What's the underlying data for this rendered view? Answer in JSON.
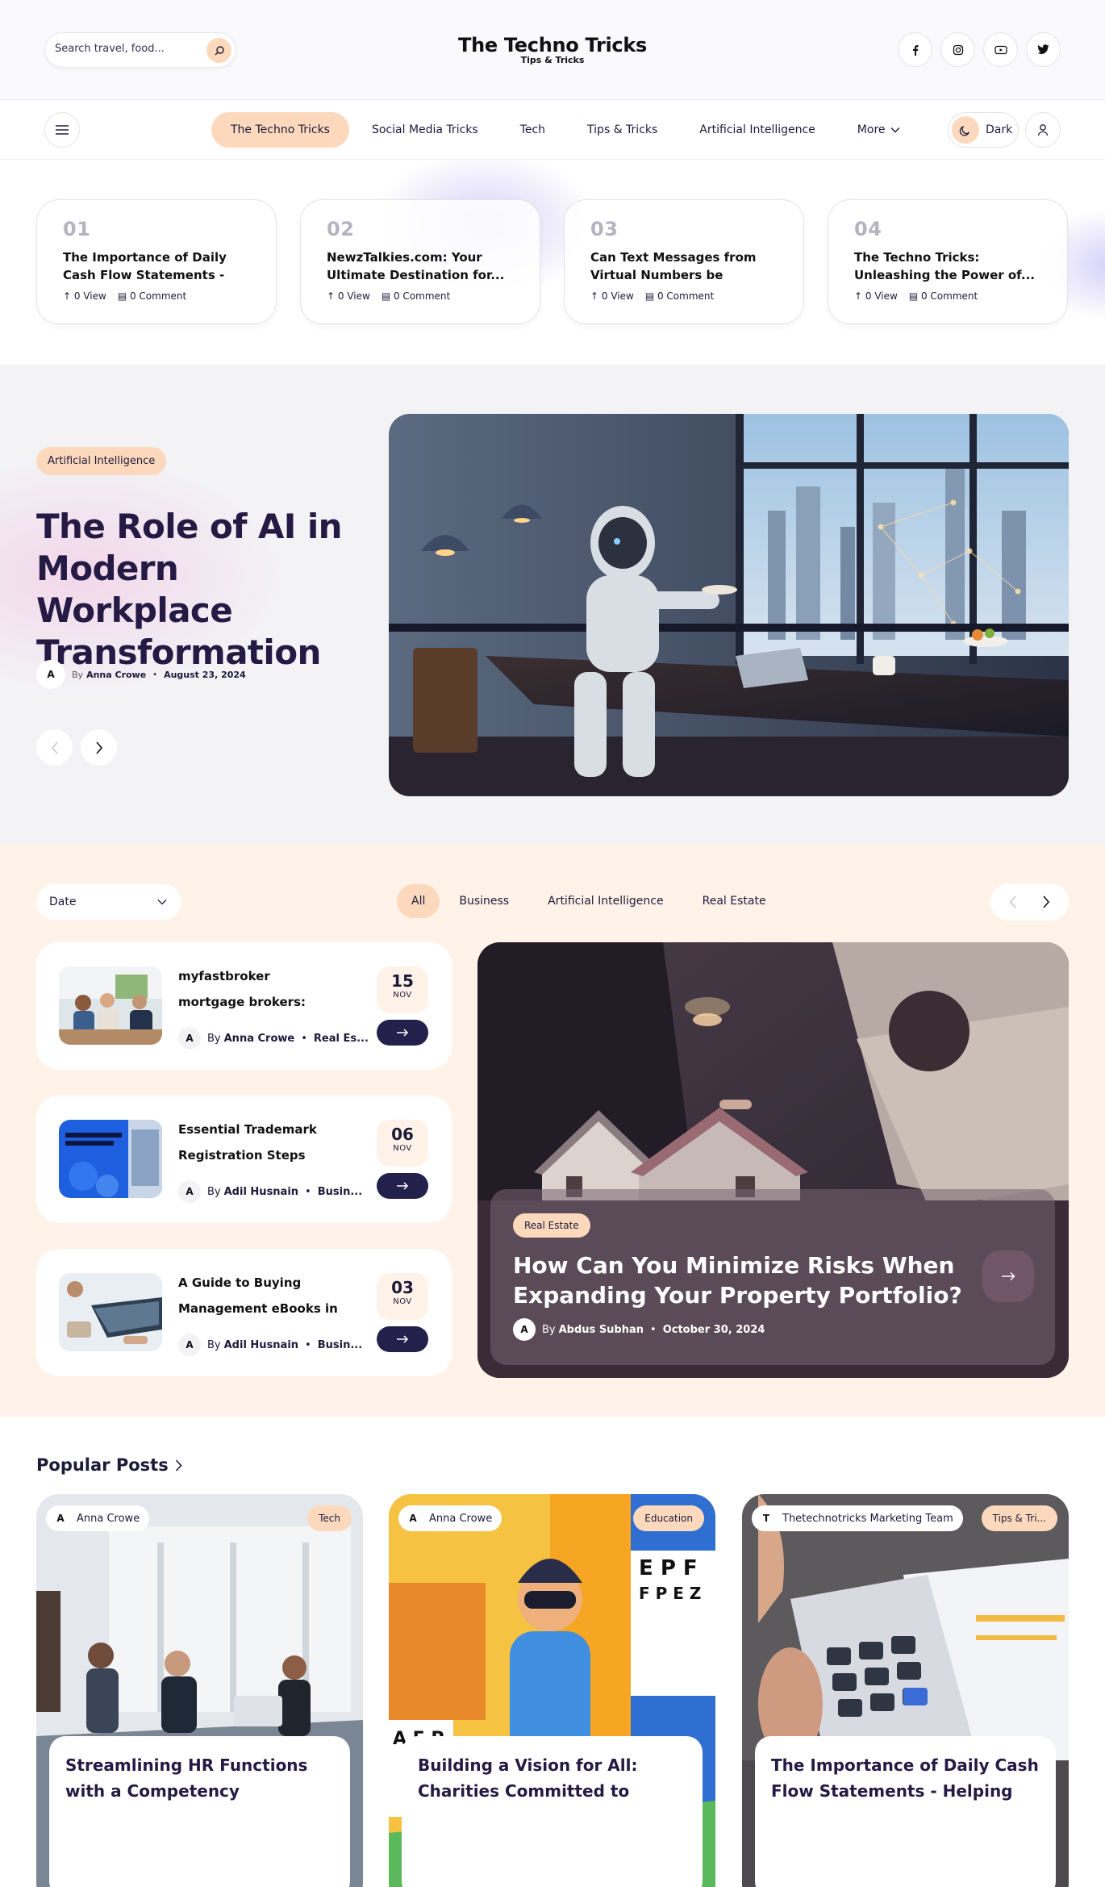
{
  "header": {
    "search_placeholder": "Search travel, food...",
    "brand_title": "The Techno Tricks",
    "brand_tagline": "Tips & Tricks",
    "socials": [
      "facebook-icon",
      "instagram-icon",
      "youtube-icon",
      "twitter-icon"
    ]
  },
  "nav": {
    "links": [
      "The Techno Tricks",
      "Social Media Tricks",
      "Tech",
      "Tips & Tricks",
      "Artificial Intelligence"
    ],
    "more_label": "More",
    "dark_label": "Dark"
  },
  "trending": [
    {
      "num": "01",
      "title": "The Importance of Daily Cash Flow Statements - Helping...",
      "views": "0 View",
      "comments": "0 Comment"
    },
    {
      "num": "02",
      "title": "NewzTalkies.com: Your Ultimate Destination for...",
      "views": "0 View",
      "comments": "0 Comment"
    },
    {
      "num": "03",
      "title": "Can Text Messages from Virtual Numbers be Traced?...",
      "views": "0 View",
      "comments": "0 Comment"
    },
    {
      "num": "04",
      "title": "The Techno Tricks: Unleashing the Power of...",
      "views": "0 View",
      "comments": "0 Comment"
    }
  ],
  "hero": {
    "category": "Artificial Intelligence",
    "title": "The Role of AI in Modern Workplace Transformation",
    "avatar": "A",
    "by": "By",
    "author": "Anna Crowe",
    "date": "August 23, 2024"
  },
  "category_section": {
    "date_filter": "Date",
    "tabs": [
      "All",
      "Business",
      "Artificial Intelligence",
      "Real Estate"
    ],
    "list": [
      {
        "title": "myfastbroker mortgage brokers: Your Trusted...",
        "avatar": "A",
        "by": "By",
        "author": "Anna Crowe",
        "category": "Real Es...",
        "day": "15",
        "month": "NOV"
      },
      {
        "title": "Essential Trademark Registration Steps for...",
        "avatar": "A",
        "by": "By",
        "author": "Adil Husnain",
        "category": "Busin...",
        "day": "06",
        "month": "NOV"
      },
      {
        "title": "A Guide to Buying Management eBooks in PD...",
        "avatar": "A",
        "by": "By",
        "author": "Adil Husnain",
        "category": "Busin...",
        "day": "03",
        "month": "NOV"
      }
    ],
    "featured": {
      "category": "Real Estate",
      "title": "How Can You Minimize Risks When Expanding Your Property Portfolio?",
      "avatar": "A",
      "by": "By",
      "author": "Abdus Subhan",
      "date": "October 30, 2024"
    }
  },
  "popular": {
    "heading": "Popular Posts",
    "posts": [
      {
        "avatar": "A",
        "author": "Anna Crowe",
        "tag": "Tech",
        "title": "Streamlining HR Functions with a Competency Framework Software"
      },
      {
        "avatar": "A",
        "author": "Anna Crowe",
        "tag": "Education",
        "title": "Building a Vision for All: Charities Committed to Empowering the..."
      },
      {
        "avatar": "T",
        "author": "Thetechnotricks Marketing Team",
        "tag": "Tips & Tri...",
        "title": "The Importance of Daily Cash Flow Statements - Helping You..."
      }
    ]
  },
  "colors": {
    "accent": "#fcd9bd",
    "dark": "#24204c",
    "cream": "#fff2e8",
    "hero_bg": "#f3f3f6"
  }
}
